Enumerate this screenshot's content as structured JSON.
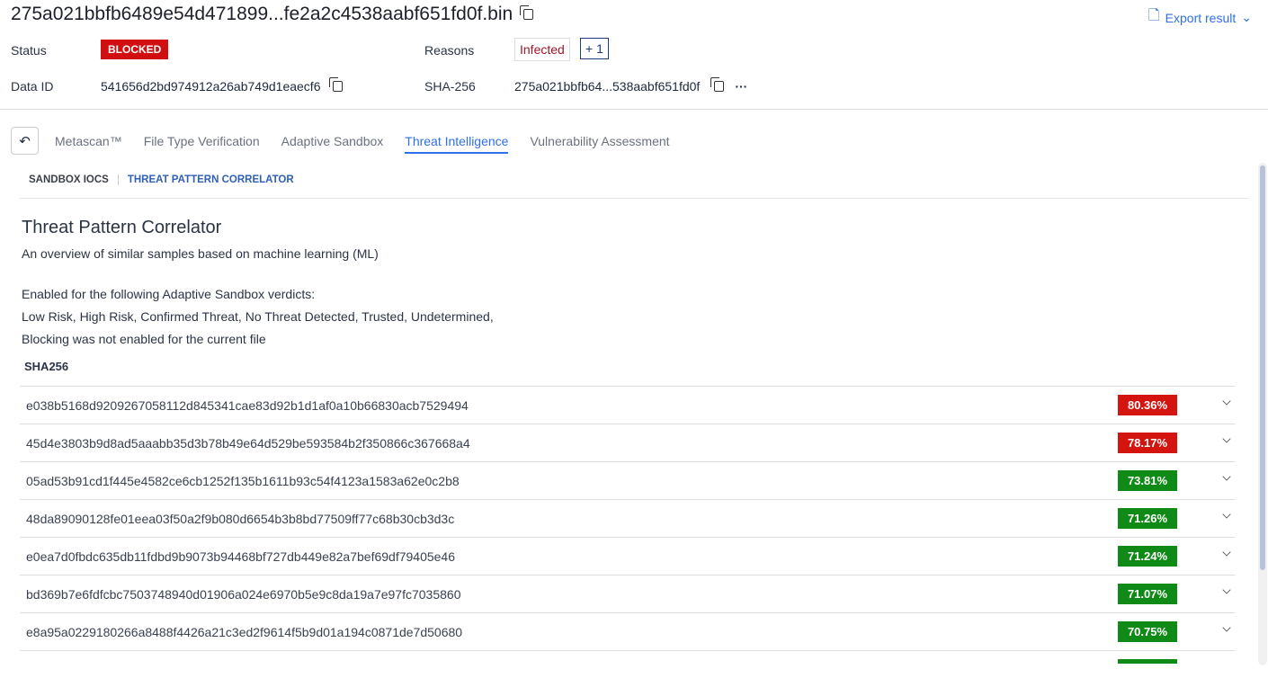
{
  "header": {
    "title": "275a021bbfb6489e54d471899...fe2a2c4538aabf651fd0f.bin",
    "export_label": "Export result"
  },
  "meta": {
    "status_label": "Status",
    "status": "BLOCKED",
    "reasons_label": "Reasons",
    "reason": "Infected",
    "reason_more": "+ 1",
    "data_id_label": "Data ID",
    "data_id": "541656d2bd974912a26ab749d1eaecf6",
    "sha_label": "SHA-256",
    "sha": "275a021bbfb64...538aabf651fd0f",
    "more": "···"
  },
  "tabs": [
    "Metascan™",
    "File Type Verification",
    "Adaptive Sandbox",
    "Threat Intelligence",
    "Vulnerability Assessment"
  ],
  "subtabs": [
    "SANDBOX IOCS",
    "THREAT PATTERN CORRELATOR"
  ],
  "section": {
    "title": "Threat Pattern Correlator",
    "desc": "An overview of similar samples based on machine learning (ML)",
    "line1": "Enabled for the following Adaptive Sandbox verdicts:",
    "line2": "Low Risk, High Risk, Confirmed Threat, No Threat Detected, Trusted, Undetermined,",
    "line3": "Blocking was not enabled for the current file",
    "col": "SHA256"
  },
  "colors": {
    "red": "#d4140f",
    "green": "#0f8a16",
    "accent": "#2f6fe8"
  },
  "rows": [
    {
      "sha": "e038b5168d9209267058112d845341cae83d92b1d1af0a10b66830acb7529494",
      "score": "80.36%",
      "level": "red"
    },
    {
      "sha": "45d4e3803b9d8ad5aaabb35d3b78b49e64d529be593584b2f350866c367668a4",
      "score": "78.17%",
      "level": "red"
    },
    {
      "sha": "05ad53b91cd1f445e4582ce6cb1252f135b1611b93c54f4123a1583a62e0c2b8",
      "score": "73.81%",
      "level": "green"
    },
    {
      "sha": "48da89090128fe01eea03f50a2f9b080d6654b3b8bd77509ff77c68b30cb3d3c",
      "score": "71.26%",
      "level": "green"
    },
    {
      "sha": "e0ea7d0fbdc635db11fdbd9b9073b94468bf727db449e82a7bef69df79405e46",
      "score": "71.24%",
      "level": "green"
    },
    {
      "sha": "bd369b7e6fdfcbc7503748940d01906a024e6970b5e9c8da19a7e97fc7035860",
      "score": "71.07%",
      "level": "green"
    },
    {
      "sha": "e8a95a0229180266a8488f4426a21c3ed2f9614f5b9d01a194c0871de7d50680",
      "score": "70.75%",
      "level": "green"
    }
  ]
}
